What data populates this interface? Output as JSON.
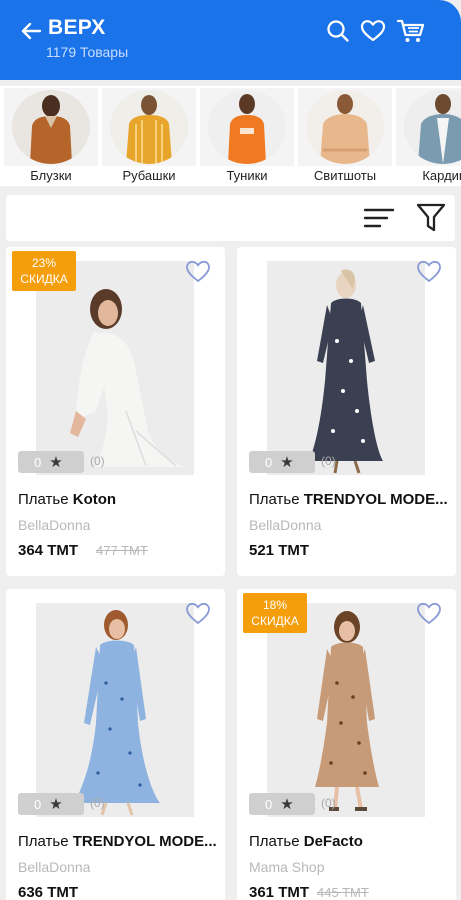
{
  "header": {
    "title": "ВЕРХ",
    "subtitle": "1179 Товары",
    "accent_color": "#1a73e8"
  },
  "categories": [
    {
      "label": "Блузки",
      "color": "#b5652a"
    },
    {
      "label": "Рубашки",
      "color": "#e7a52c"
    },
    {
      "label": "Туники",
      "color": "#f07a22"
    },
    {
      "label": "Свитшоты",
      "color": "#e8b88c"
    },
    {
      "label": "Кардиг",
      "color": "#7a9bb0"
    }
  ],
  "products": [
    {
      "badge_pct": "23%",
      "badge_label": "СКИДКА",
      "rating": "0",
      "rating_count": "(0)",
      "name_prefix": "Платье ",
      "name_brand": "Koton",
      "seller": "BellaDonna",
      "price": "364 TMT",
      "old_price": "477 TMT",
      "dress_color": "#f5f5f3"
    },
    {
      "rating": "0",
      "rating_count": "(0)",
      "name_prefix": "Платье ",
      "name_brand": "TRENDYOL MODE...",
      "seller": "BellaDonna",
      "price": "521 TMT",
      "dress_color": "#3b3f52"
    },
    {
      "rating": "0",
      "rating_count": "(0)",
      "name_prefix": "Платье ",
      "name_brand": "TRENDYOL MODE...",
      "seller": "BellaDonna",
      "price": "636 TMT",
      "dress_color": "#8fb3e0"
    },
    {
      "badge_pct": "18%",
      "badge_label": "СКИДКА",
      "rating": "0",
      "rating_count": "(0)",
      "name_prefix": "Платье ",
      "name_brand": "DeFacto",
      "seller": "Mama Shop",
      "price": "361 TMT",
      "old_price": "445 TMT",
      "dress_color": "#c79b78"
    }
  ],
  "icons": {
    "back": "arrow-left-icon",
    "search": "search-icon",
    "favorites": "heart-icon",
    "cart": "cart-icon",
    "sort": "sort-icon",
    "filter": "filter-icon",
    "star": "★"
  }
}
